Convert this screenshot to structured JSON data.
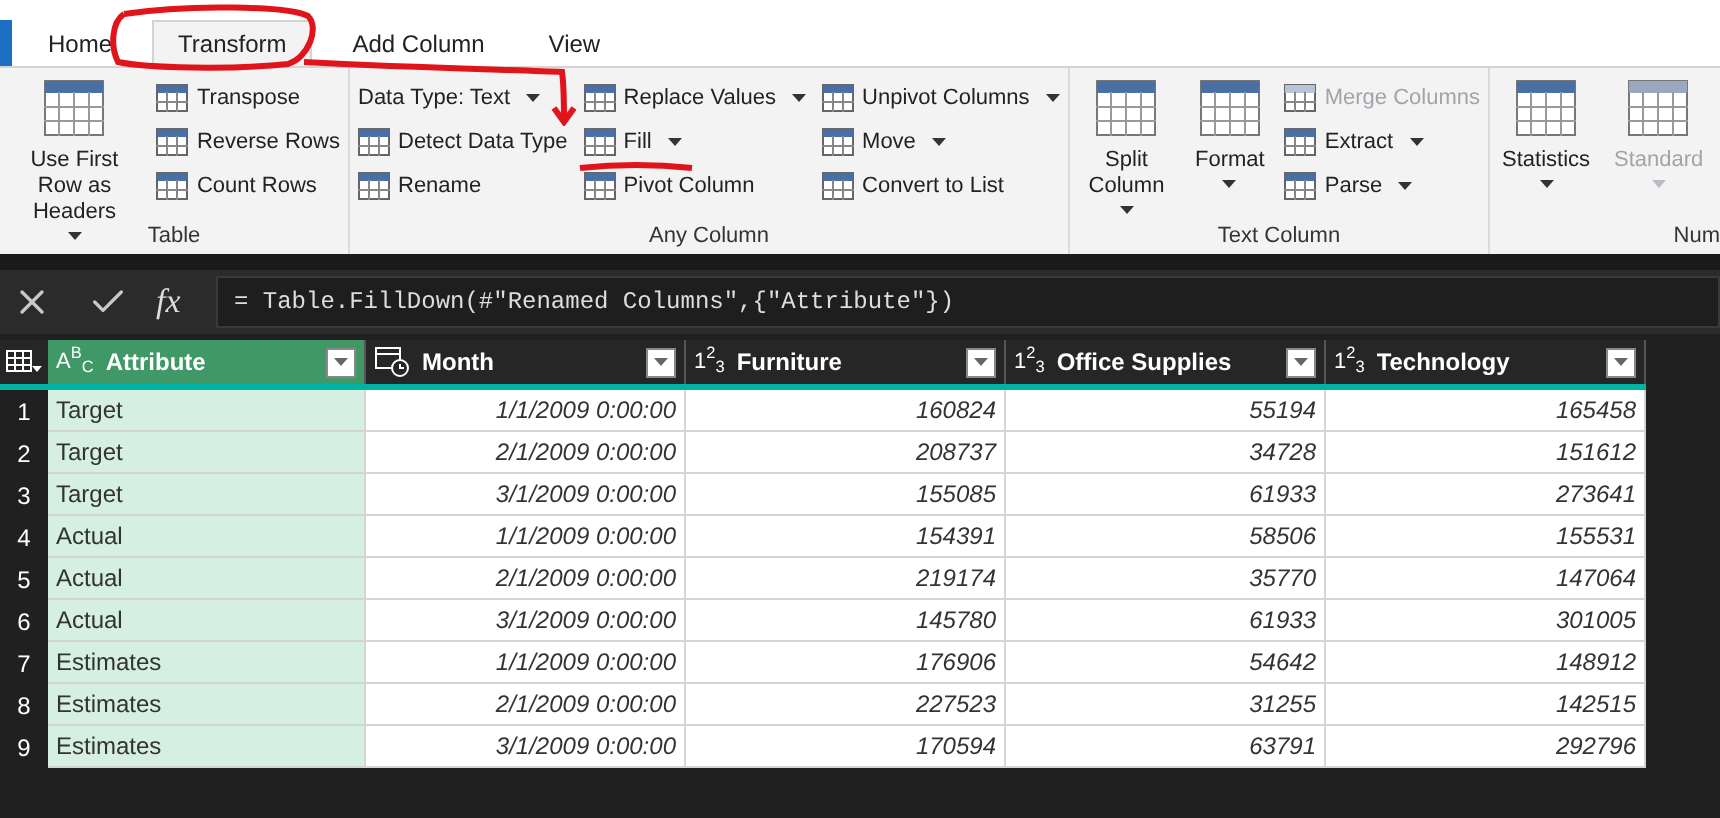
{
  "tabs": [
    {
      "label": "Home",
      "selected": false
    },
    {
      "label": "Transform",
      "selected": true
    },
    {
      "label": "Add Column",
      "selected": false
    },
    {
      "label": "View",
      "selected": false
    }
  ],
  "ribbon": {
    "groups": [
      {
        "label": "Table",
        "columns": [
          [
            {
              "kind": "large",
              "label": "Use First Row as Headers",
              "dropdown": true,
              "disabled": false
            }
          ],
          [
            {
              "kind": "small",
              "label": "Transpose",
              "dropdown": false,
              "disabled": false
            },
            {
              "kind": "small",
              "label": "Reverse Rows",
              "dropdown": false,
              "disabled": false
            },
            {
              "kind": "small",
              "label": "Count Rows",
              "dropdown": false,
              "disabled": false
            }
          ]
        ]
      },
      {
        "label": "Any Column",
        "columns": [
          [
            {
              "kind": "plain",
              "label": "Data Type: Text",
              "dropdown": true,
              "disabled": false
            },
            {
              "kind": "small",
              "label": "Detect Data Type",
              "dropdown": false,
              "disabled": false
            },
            {
              "kind": "small",
              "label": "Rename",
              "dropdown": false,
              "disabled": false
            }
          ],
          [
            {
              "kind": "small",
              "label": "Replace Values",
              "dropdown": true,
              "disabled": false
            },
            {
              "kind": "small",
              "label": "Fill",
              "dropdown": true,
              "disabled": false
            },
            {
              "kind": "small",
              "label": "Pivot Column",
              "dropdown": false,
              "disabled": false
            }
          ],
          [
            {
              "kind": "small",
              "label": "Unpivot Columns",
              "dropdown": true,
              "disabled": false
            },
            {
              "kind": "small",
              "label": "Move",
              "dropdown": true,
              "disabled": false
            },
            {
              "kind": "small",
              "label": "Convert to List",
              "dropdown": false,
              "disabled": false
            }
          ]
        ]
      },
      {
        "label": "Text Column",
        "columns": [
          [
            {
              "kind": "large",
              "label": "Split Column",
              "dropdown": true,
              "disabled": false
            }
          ],
          [
            {
              "kind": "large",
              "label": "Format",
              "dropdown": true,
              "disabled": false
            }
          ],
          [
            {
              "kind": "small",
              "label": "Merge Columns",
              "dropdown": false,
              "disabled": true
            },
            {
              "kind": "small",
              "label": "Extract",
              "dropdown": true,
              "disabled": false
            },
            {
              "kind": "small",
              "label": "Parse",
              "dropdown": true,
              "disabled": false
            }
          ]
        ]
      },
      {
        "label": "Num",
        "columns": [
          [
            {
              "kind": "large",
              "label": "Statistics",
              "dropdown": true,
              "disabled": false
            }
          ],
          [
            {
              "kind": "large",
              "label": "Standard",
              "dropdown": true,
              "disabled": true
            }
          ]
        ]
      }
    ]
  },
  "formula_bar": {
    "fx": "fx",
    "formula": "= Table.FillDown(#\"Renamed Columns\",{\"Attribute\"})"
  },
  "table": {
    "columns": [
      {
        "name": "Attribute",
        "kind": "text",
        "type_label": "A$^{B}$$_{C}$",
        "selected": true
      },
      {
        "name": "Month",
        "kind": "date",
        "selected": false
      },
      {
        "name": "Furniture",
        "kind": "number",
        "type_label": "1$^{2}$$_{3}$",
        "selected": false
      },
      {
        "name": "Office Supplies",
        "kind": "number",
        "type_label": "1$^{2}$$_{3}$",
        "selected": false
      },
      {
        "name": "Technology",
        "kind": "number",
        "type_label": "1$^{2}$$_{3}$",
        "selected": false
      }
    ],
    "rows": [
      {
        "number": "1",
        "cells": [
          "Target",
          "1/1/2009 0:00:00",
          "160824",
          "55194",
          "165458"
        ]
      },
      {
        "number": "2",
        "cells": [
          "Target",
          "2/1/2009 0:00:00",
          "208737",
          "34728",
          "151612"
        ]
      },
      {
        "number": "3",
        "cells": [
          "Target",
          "3/1/2009 0:00:00",
          "155085",
          "61933",
          "273641"
        ]
      },
      {
        "number": "4",
        "cells": [
          "Actual",
          "1/1/2009 0:00:00",
          "154391",
          "58506",
          "155531"
        ]
      },
      {
        "number": "5",
        "cells": [
          "Actual",
          "2/1/2009 0:00:00",
          "219174",
          "35770",
          "147064"
        ]
      },
      {
        "number": "6",
        "cells": [
          "Actual",
          "3/1/2009 0:00:00",
          "145780",
          "61933",
          "301005"
        ]
      },
      {
        "number": "7",
        "cells": [
          "Estimates",
          "1/1/2009 0:00:00",
          "176906",
          "54642",
          "148912"
        ]
      },
      {
        "number": "8",
        "cells": [
          "Estimates",
          "2/1/2009 0:00:00",
          "227523",
          "31255",
          "142515"
        ]
      },
      {
        "number": "9",
        "cells": [
          "Estimates",
          "3/1/2009 0:00:00",
          "170594",
          "63791",
          "292796"
        ]
      }
    ]
  }
}
